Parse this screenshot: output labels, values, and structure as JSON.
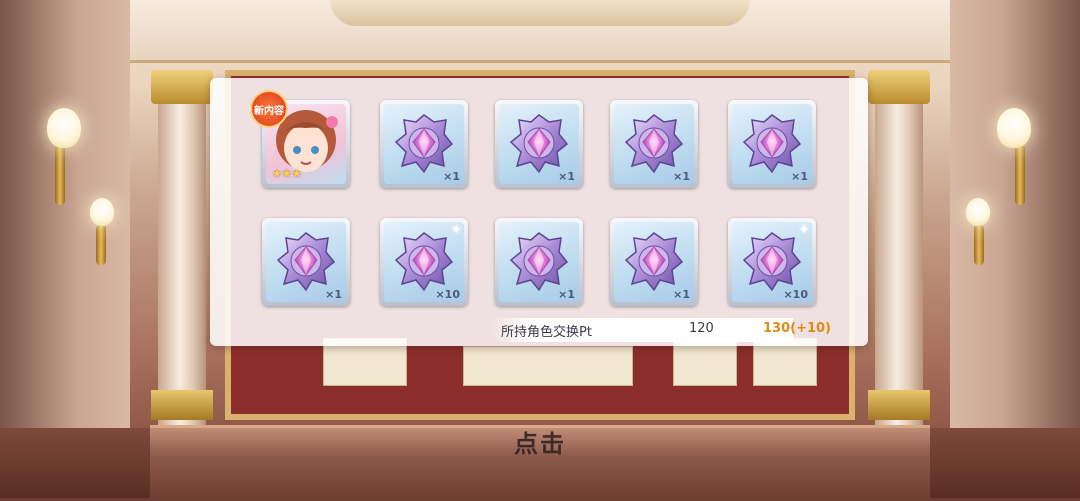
{
  "tap_label": "点击",
  "new_badge": "新内容",
  "character": {
    "rarity_stars": 3
  },
  "items": [
    {
      "icon": "purple-gem-icon",
      "quantity": "×1"
    },
    {
      "icon": "purple-gem-icon",
      "quantity": "×1"
    },
    {
      "icon": "purple-gem-icon",
      "quantity": "×1"
    },
    {
      "icon": "purple-gem-icon",
      "quantity": "×1"
    },
    {
      "icon": "purple-gem-icon",
      "quantity": "×1"
    },
    {
      "icon": "purple-gem-icon",
      "quantity": "×10"
    },
    {
      "icon": "purple-gem-icon",
      "quantity": "×1"
    },
    {
      "icon": "purple-gem-icon",
      "quantity": "×1"
    },
    {
      "icon": "purple-gem-icon",
      "quantity": "×10"
    }
  ],
  "exchange": {
    "label": "所持角色交换Pt",
    "current": "120",
    "new_value": "130(+10)"
  },
  "colors": {
    "accent_orange": "#e08a12",
    "board_red": "#8c2f2c",
    "gold": "#d9b36c"
  }
}
